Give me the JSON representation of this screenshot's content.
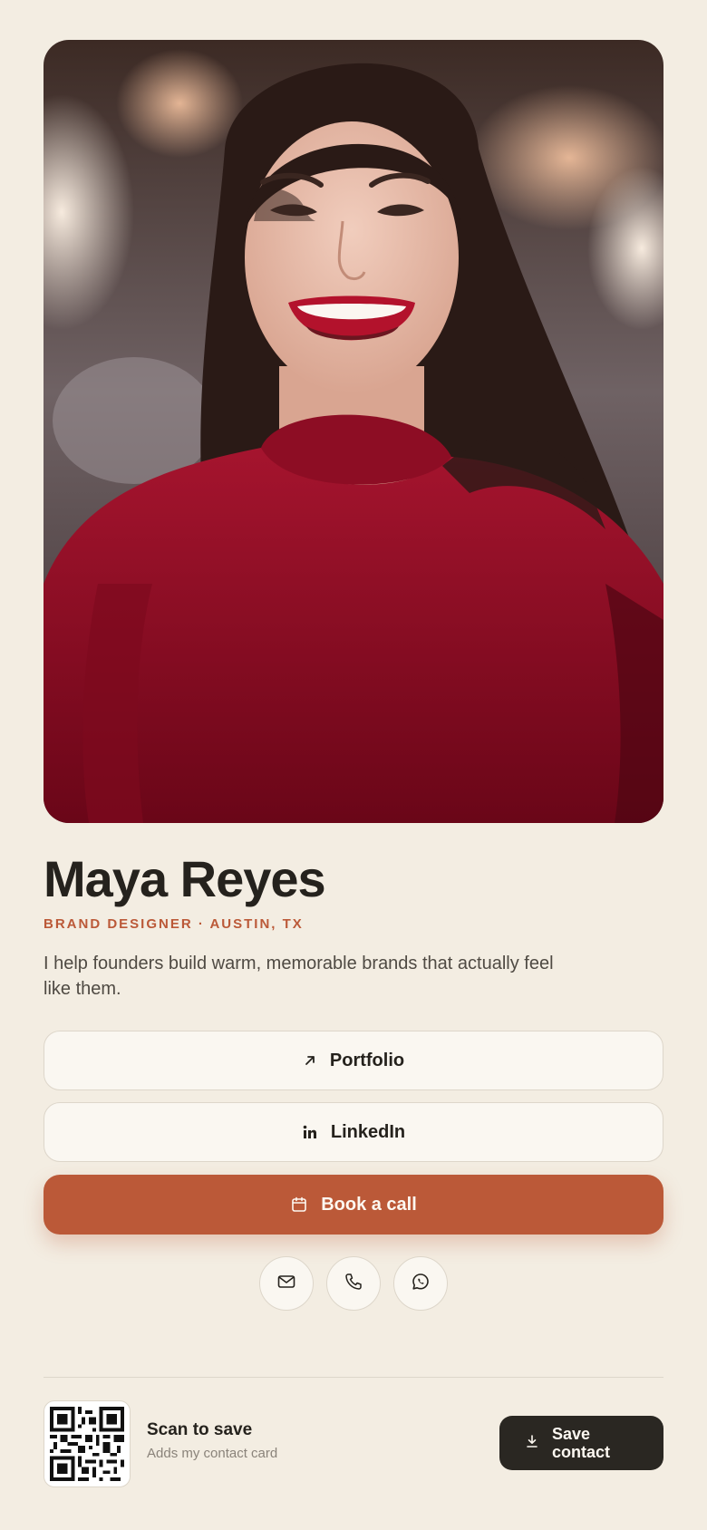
{
  "profile": {
    "name": "Maya Reyes",
    "role": "BRAND DESIGNER · AUSTIN, TX",
    "bio": "I help founders build warm, memorable brands that actually feel like them."
  },
  "buttons": {
    "portfolio": "Portfolio",
    "linkedin": "LinkedIn",
    "book": "Book a call"
  },
  "contact_icons": [
    "mail-icon",
    "phone-icon",
    "whatsapp-icon"
  ],
  "footer": {
    "scan_title": "Scan to save",
    "scan_subtitle": "Adds my contact card",
    "save_button": "Save contact"
  },
  "colors": {
    "background": "#f3ede2",
    "accent": "#bb5938",
    "dark": "#2a2722"
  }
}
